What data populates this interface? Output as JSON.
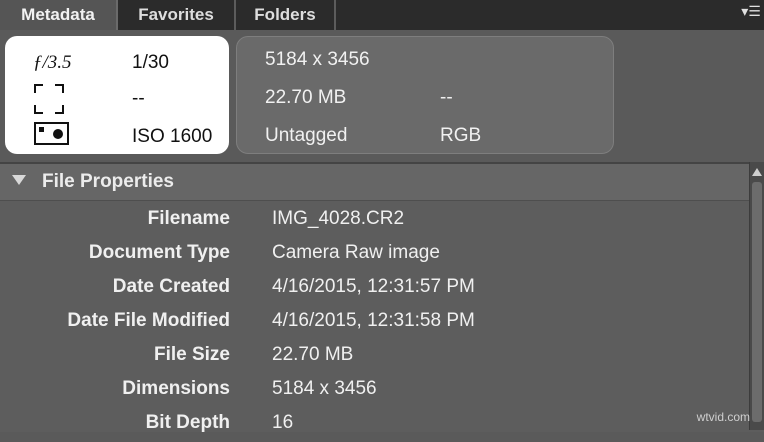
{
  "tabs": [
    {
      "label": "Metadata",
      "active": true
    },
    {
      "label": "Favorites",
      "active": false
    },
    {
      "label": "Folders",
      "active": false
    }
  ],
  "panel_menu_icon": "panel-menu-icon",
  "camera": {
    "aperture": "ƒ/3.5",
    "shutter": "1/30",
    "metering": "--",
    "iso": "ISO 1600",
    "icons": [
      "metering-mode-icon",
      "camera-mode-icon"
    ]
  },
  "image_info": {
    "dimensions": "5184 x 3456",
    "file_size": "22.70 MB",
    "resolution": "--",
    "color_profile": "Untagged",
    "color_mode": "RGB"
  },
  "file_properties": {
    "title": "File Properties",
    "rows": [
      {
        "label": "Filename",
        "value": "IMG_4028.CR2"
      },
      {
        "label": "Document Type",
        "value": "Camera Raw image"
      },
      {
        "label": "Date Created",
        "value": "4/16/2015, 12:31:57 PM"
      },
      {
        "label": "Date File Modified",
        "value": "4/16/2015, 12:31:58 PM"
      },
      {
        "label": "File Size",
        "value": "22.70 MB"
      },
      {
        "label": "Dimensions",
        "value": "5184 x 3456"
      },
      {
        "label": "Bit Depth",
        "value": "16"
      }
    ]
  },
  "colors": {
    "panel_bg": "#5a5a5a",
    "tab_bar": "#2b2b2b",
    "active_tab": "#555555",
    "camera_box": "#ffffff"
  },
  "watermark": "wtvid.com"
}
